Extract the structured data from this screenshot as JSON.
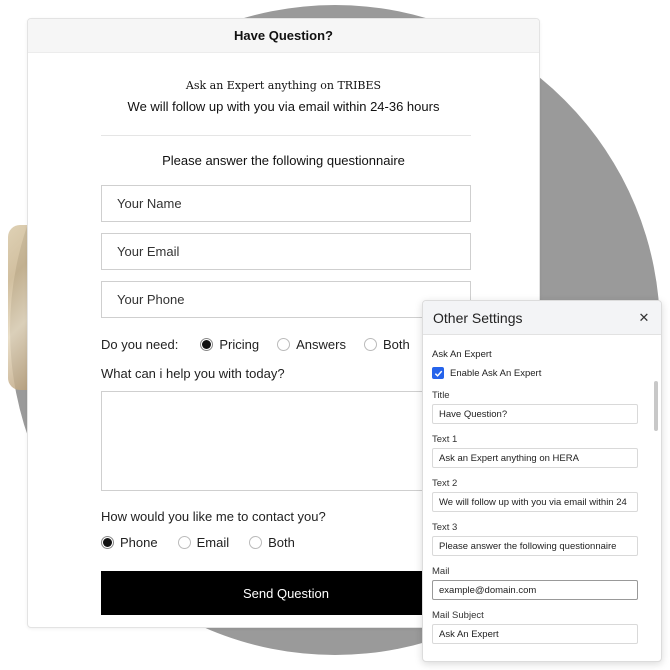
{
  "form": {
    "title": "Have Question?",
    "text1": "Ask an Expert anything on TRIBES",
    "text2": "We will follow up with you via email within 24-36 hours",
    "text3": "Please answer the following questionnaire",
    "name_placeholder": "Your Name",
    "email_placeholder": "Your Email",
    "phone_placeholder": "Your Phone",
    "need_label": "Do you need:",
    "need_options": [
      {
        "label": "Pricing",
        "selected": true
      },
      {
        "label": "Answers",
        "selected": false
      },
      {
        "label": "Both",
        "selected": false
      }
    ],
    "help_label": "What can i help you with today?",
    "contact_label": "How would you like me to contact you?",
    "contact_options": [
      {
        "label": "Phone",
        "selected": true
      },
      {
        "label": "Email",
        "selected": false
      },
      {
        "label": "Both",
        "selected": false
      }
    ],
    "send_label": "Send Question"
  },
  "settings": {
    "title": "Other Settings",
    "close_icon": "close-icon",
    "section_label": "Ask An Expert",
    "enable_label": "Enable Ask An Expert",
    "enable_checked": true,
    "fields": [
      {
        "label": "Title",
        "value": "Have Question?"
      },
      {
        "label": "Text 1",
        "value": "Ask an Expert anything on HERA"
      },
      {
        "label": "Text 2",
        "value": "We will follow up with you via email within 24"
      },
      {
        "label": "Text 3",
        "value": "Please answer the following questionnaire"
      },
      {
        "label": "Mail",
        "value": "example@domain.com"
      },
      {
        "label": "Mail Subject",
        "value": "Ask An Expert"
      }
    ]
  },
  "colors": {
    "accent": "#2563eb",
    "button": "#000000",
    "background_circle": "#9a9a9a"
  }
}
